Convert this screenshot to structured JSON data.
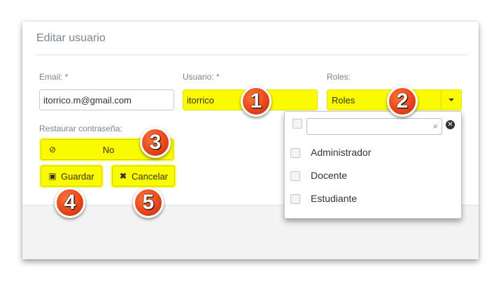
{
  "dialog": {
    "title": "Editar usuario"
  },
  "form": {
    "email_label": "Email: *",
    "email_value": "itorrico.m@gmail.com",
    "user_label": "Usuario: *",
    "user_value": "itorrico",
    "roles_label": "Roles:",
    "roles_value": "Roles",
    "reset_label": "Restaurar contraseña:",
    "reset_value": "No"
  },
  "buttons": {
    "save_label": "Guardar",
    "cancel_label": "Cancelar"
  },
  "roles_dropdown": {
    "search_placeholder": "",
    "options": [
      {
        "label": "Administrador",
        "checked": false
      },
      {
        "label": "Docente",
        "checked": false
      },
      {
        "label": "Estudiante",
        "checked": false
      }
    ]
  },
  "callouts": [
    "1",
    "2",
    "3",
    "4",
    "5"
  ],
  "colors": {
    "highlight": "#fbfb00",
    "callout": "#e8461b"
  },
  "icons": {
    "reset": "ban-icon",
    "save": "floppy-disk-icon",
    "cancel": "x-icon",
    "search": "magnifier-icon",
    "clear": "clear-circle-icon",
    "caret": "caret-down-icon"
  }
}
